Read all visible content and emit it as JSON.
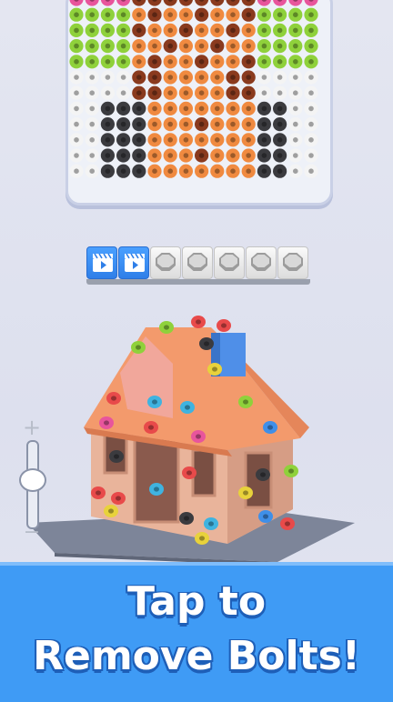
{
  "banner": {
    "line1": "Tap to",
    "line2": "Remove Bolts!"
  },
  "slots": [
    {
      "state": "video",
      "icon": "video-icon"
    },
    {
      "state": "video",
      "icon": "video-icon"
    },
    {
      "state": "empty",
      "icon": "empty-slot-icon"
    },
    {
      "state": "empty",
      "icon": "empty-slot-icon"
    },
    {
      "state": "empty",
      "icon": "empty-slot-icon"
    },
    {
      "state": "empty",
      "icon": "empty-slot-icon"
    },
    {
      "state": "empty",
      "icon": "empty-slot-icon"
    }
  ],
  "zoom": {
    "plus": "+",
    "minus": "−",
    "level": 0.55
  },
  "colors": {
    "pink": "#e8559c",
    "lime": "#8fd13b",
    "orange": "#f08a40",
    "brown": "#8a3a1e",
    "white": "#f4f4f4",
    "black": "#3b3b3f",
    "banner": "#3f9bf5"
  }
}
